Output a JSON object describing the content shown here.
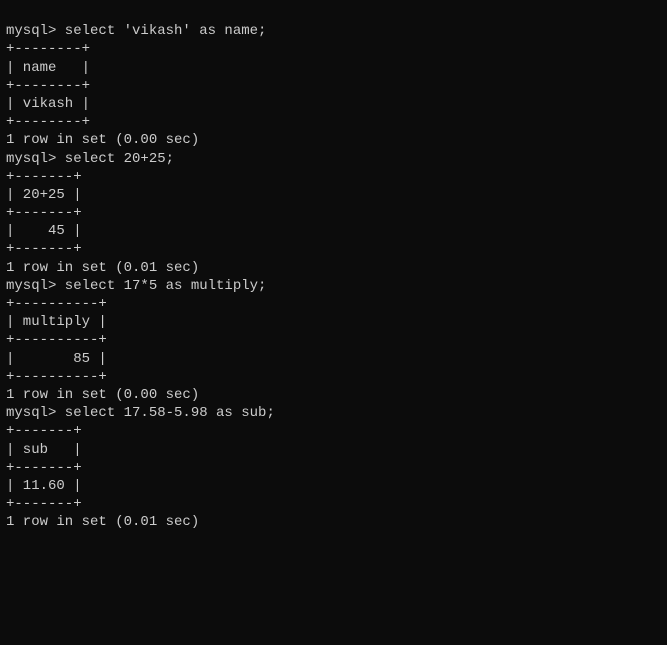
{
  "prompt": "mysql>",
  "queries": [
    {
      "cmd": "select 'vikash' as name;",
      "border": "+--------+",
      "header": "| name   |",
      "rows": [
        "| vikash |"
      ],
      "status": "1 row in set (0.00 sec)"
    },
    {
      "cmd": "select 20+25;",
      "border": "+-------+",
      "header": "| 20+25 |",
      "rows": [
        "|    45 |"
      ],
      "status": "1 row in set (0.01 sec)"
    },
    {
      "cmd": "select 17*5 as multiply;",
      "border": "+----------+",
      "header": "| multiply |",
      "rows": [
        "|       85 |"
      ],
      "status": "1 row in set (0.00 sec)"
    },
    {
      "cmd": "select 17.58-5.98 as sub;",
      "border": "+-------+",
      "header": "| sub   |",
      "rows": [
        "| 11.60 |"
      ],
      "status": "1 row in set (0.01 sec)"
    }
  ]
}
